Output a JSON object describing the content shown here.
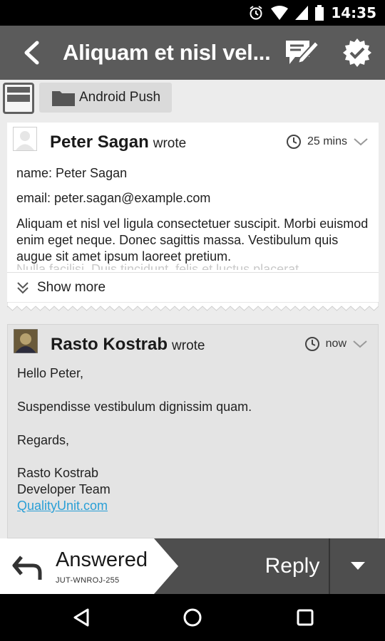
{
  "status_bar": {
    "time": "14:35"
  },
  "action_bar": {
    "title": "Aliquam et nisl vel..."
  },
  "folder": {
    "label": "Android Push"
  },
  "messages": [
    {
      "sender": "Peter Sagan",
      "wrote": "wrote",
      "time": "25 mins",
      "lines": [
        "name: Peter Sagan",
        "email: peter.sagan@example.com"
      ],
      "body": "Aliquam et nisl vel ligula consectetuer suscipit. Morbi euismod enim eget neque. Donec sagittis massa. Vestibulum quis augue sit amet ipsum laoreet pretium.",
      "body_cut": "Nulla facilisi. Duis tincidunt, felis et luctus placerat",
      "show_more": "Show more"
    },
    {
      "sender": "Rasto Kostrab",
      "wrote": "wrote",
      "time": "now",
      "greeting": "Hello Peter,",
      "text": "Suspendisse vestibulum dignissim quam.",
      "regards": "Regards,",
      "sig_name": "Rasto Kostrab",
      "sig_team": "Developer Team",
      "sig_link": "QualityUnit.com"
    }
  ],
  "bottom_bar": {
    "status": "Answered",
    "ticket_code": "JUT-WNROJ-255",
    "reply_label": "Reply"
  },
  "colors": {
    "action_bar": "#5b5b5b",
    "link": "#2a9fd6",
    "bottom_bar": "#4e4e4e"
  }
}
